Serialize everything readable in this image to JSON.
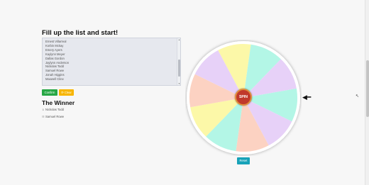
{
  "header": {
    "title": "Fill up the list and start!"
  },
  "names": [
    "Ernest Villarreal",
    "Korbin Mckay",
    "Emery Ayers",
    "Kaylynn Meyer",
    "Dallas Gordon",
    "Jaylynn Anderson",
    "Nickolas Todd",
    "Samuel Rowe",
    "Jonah Higgins",
    "Maxwell Cline"
  ],
  "buttons": {
    "confirm": "Confirm",
    "clear": "Clear",
    "spin": "SPIN",
    "reset": "Reset"
  },
  "winner": {
    "title": "The Winner",
    "entries": [
      "Nickolas Todd",
      "Samuel Rowe"
    ]
  },
  "icons": {
    "refresh": "refresh-icon",
    "trophy": "trophy-icon",
    "list": "list-icon",
    "pointer": "arrow-left-icon"
  },
  "wheel": {
    "colors": [
      "#b3f6e6",
      "#e7d1f8",
      "#fcd2c2",
      "#b3f6e6",
      "#fcf8a8",
      "#fcd2c2",
      "#e7d1f8",
      "#fcf8a8",
      "#b3f6e6",
      "#e7d1f8"
    ]
  },
  "colors": {
    "confirm": "#27a745",
    "clear": "#f7b500",
    "reset": "#17a2b8",
    "spin": "#c0392b"
  }
}
